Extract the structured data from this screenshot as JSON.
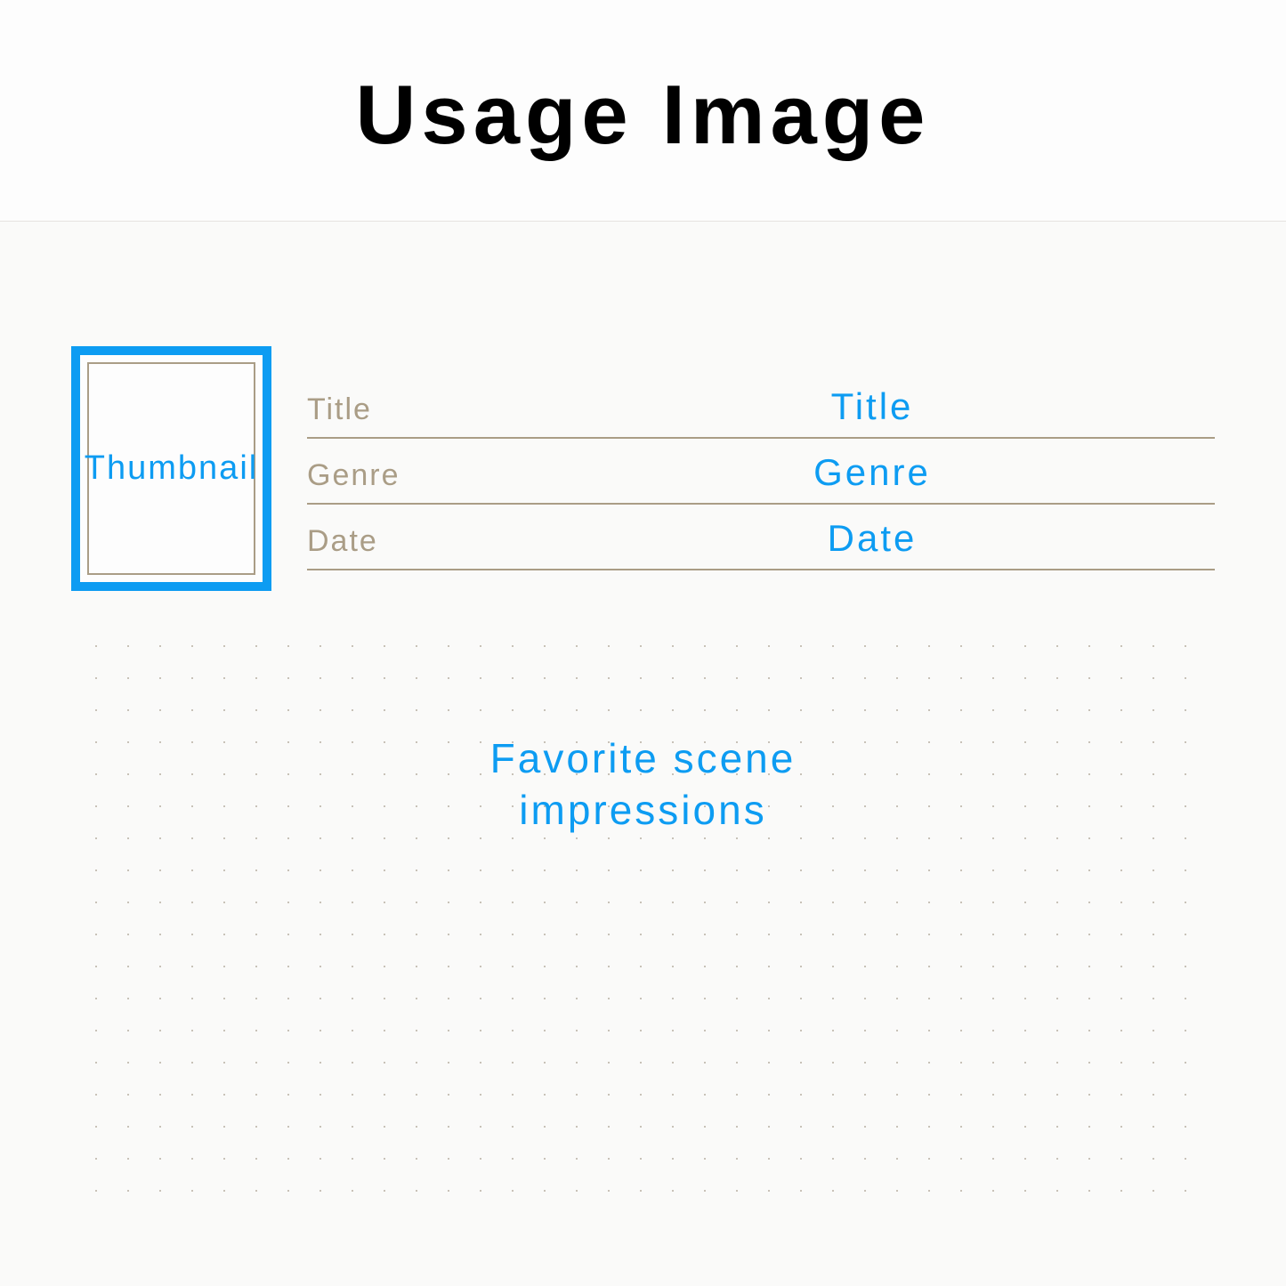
{
  "header": {
    "title": "Usage Image"
  },
  "thumbnail": {
    "label": "Thumbnail"
  },
  "fields": [
    {
      "label": "Title",
      "value": "Title"
    },
    {
      "label": "Genre",
      "value": "Genre"
    },
    {
      "label": "Date",
      "value": "Date"
    }
  ],
  "notes": {
    "line1": "Favorite scene",
    "line2": "impressions"
  },
  "colors": {
    "accent": "#0d9cf2",
    "muted": "#aa9d86"
  }
}
